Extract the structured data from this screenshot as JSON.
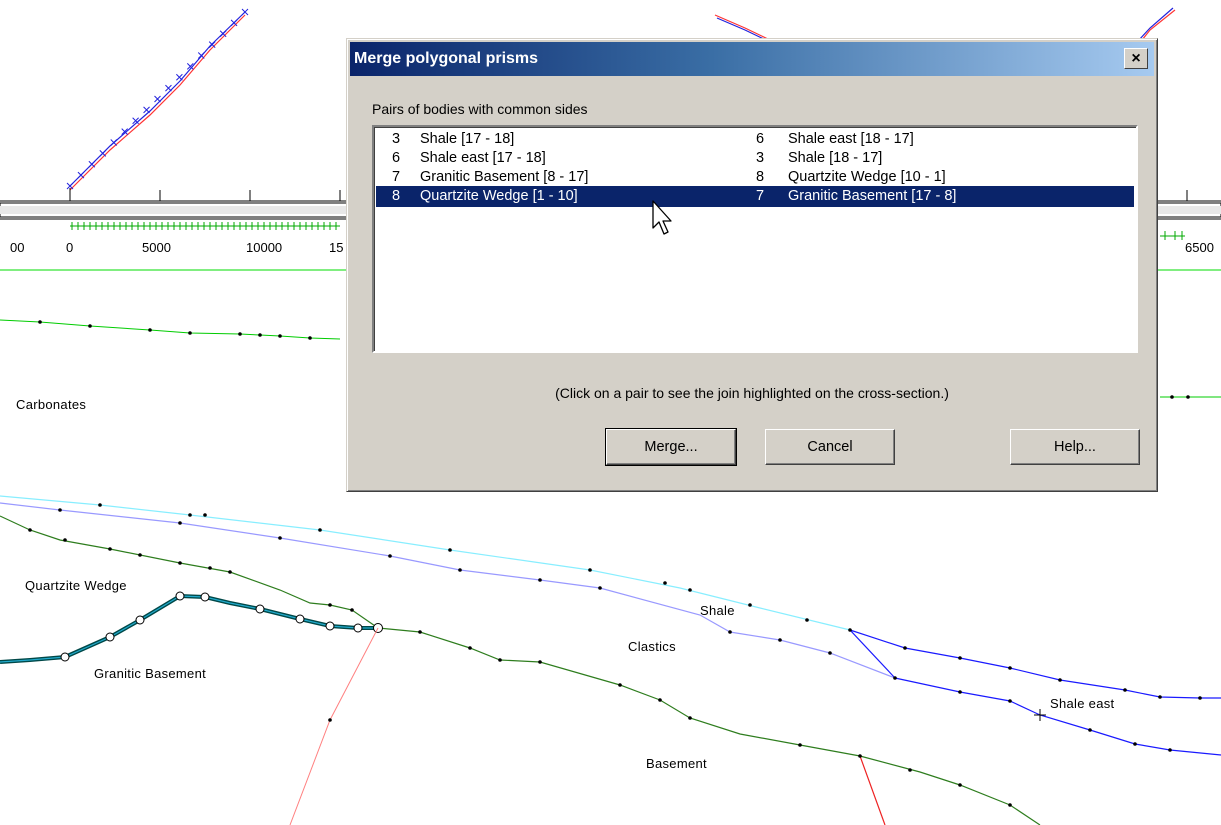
{
  "background": {
    "axis_tick_labels": [
      "00",
      "0",
      "5000",
      "10000",
      "15",
      "6500"
    ],
    "body_labels": {
      "carbonates": "Carbonates",
      "quartzite_wedge": "Quartzite Wedge",
      "granitic_basement": "Granitic Basement",
      "shale": "Shale",
      "clastics": "Clastics",
      "shale_east": "Shale east",
      "basement": "Basement"
    }
  },
  "dialog": {
    "title": "Merge polygonal prisms",
    "close_symbol": "×",
    "list_label": "Pairs of bodies with common sides",
    "pairs": [
      {
        "left_id": "3",
        "left_name": "Shale [17 - 18]",
        "right_id": "6",
        "right_name": "Shale east [18 - 17]",
        "selected": false
      },
      {
        "left_id": "6",
        "left_name": "Shale east [17 - 18]",
        "right_id": "3",
        "right_name": "Shale [18 - 17]",
        "selected": false
      },
      {
        "left_id": "7",
        "left_name": "Granitic Basement [8 - 17]",
        "right_id": "8",
        "right_name": "Quartzite Wedge [10 - 1]",
        "selected": false
      },
      {
        "left_id": "8",
        "left_name": "Quartzite Wedge [1 - 10]",
        "right_id": "7",
        "right_name": "Granitic Basement [17 - 8]",
        "selected": true
      }
    ],
    "hint": "(Click on a pair to see the join highlighted on the cross-section.)",
    "buttons": {
      "merge": "Merge...",
      "cancel": "Cancel",
      "help": "Help..."
    }
  },
  "colors": {
    "selection": "#0a246a",
    "dialog_face": "#d4d0c8",
    "green_line": "#00cc00",
    "dark_green": "#2e7d1e",
    "cyan_line": "#80ffff",
    "lavender_line": "#9999ff",
    "blue_line": "#1a1aff",
    "red_line": "#ff6666"
  }
}
